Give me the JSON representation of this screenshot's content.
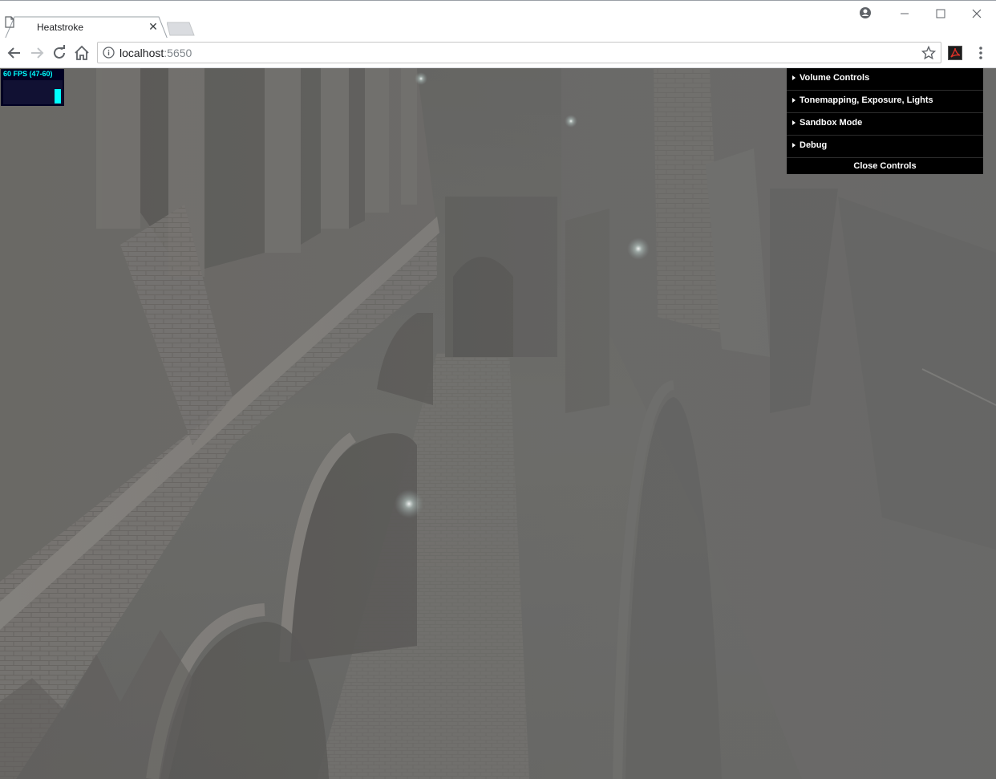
{
  "browser": {
    "tab": {
      "title": "Heatstroke"
    },
    "address": {
      "host": "localhost",
      "port": ":5650"
    }
  },
  "stats": {
    "fps_label": "60 FPS (47-60)",
    "fps_level": 0.6
  },
  "gui": {
    "folders": [
      {
        "label": "Volume Controls"
      },
      {
        "label": "Tonemapping, Exposure, Lights"
      },
      {
        "label": "Sandbox Mode"
      },
      {
        "label": "Debug"
      }
    ],
    "close_label": "Close Controls"
  },
  "colors": {
    "fog": "#6e6e6b",
    "stone": "#8c8783",
    "panel": "#000000",
    "fps_accent": "#00ffff"
  }
}
